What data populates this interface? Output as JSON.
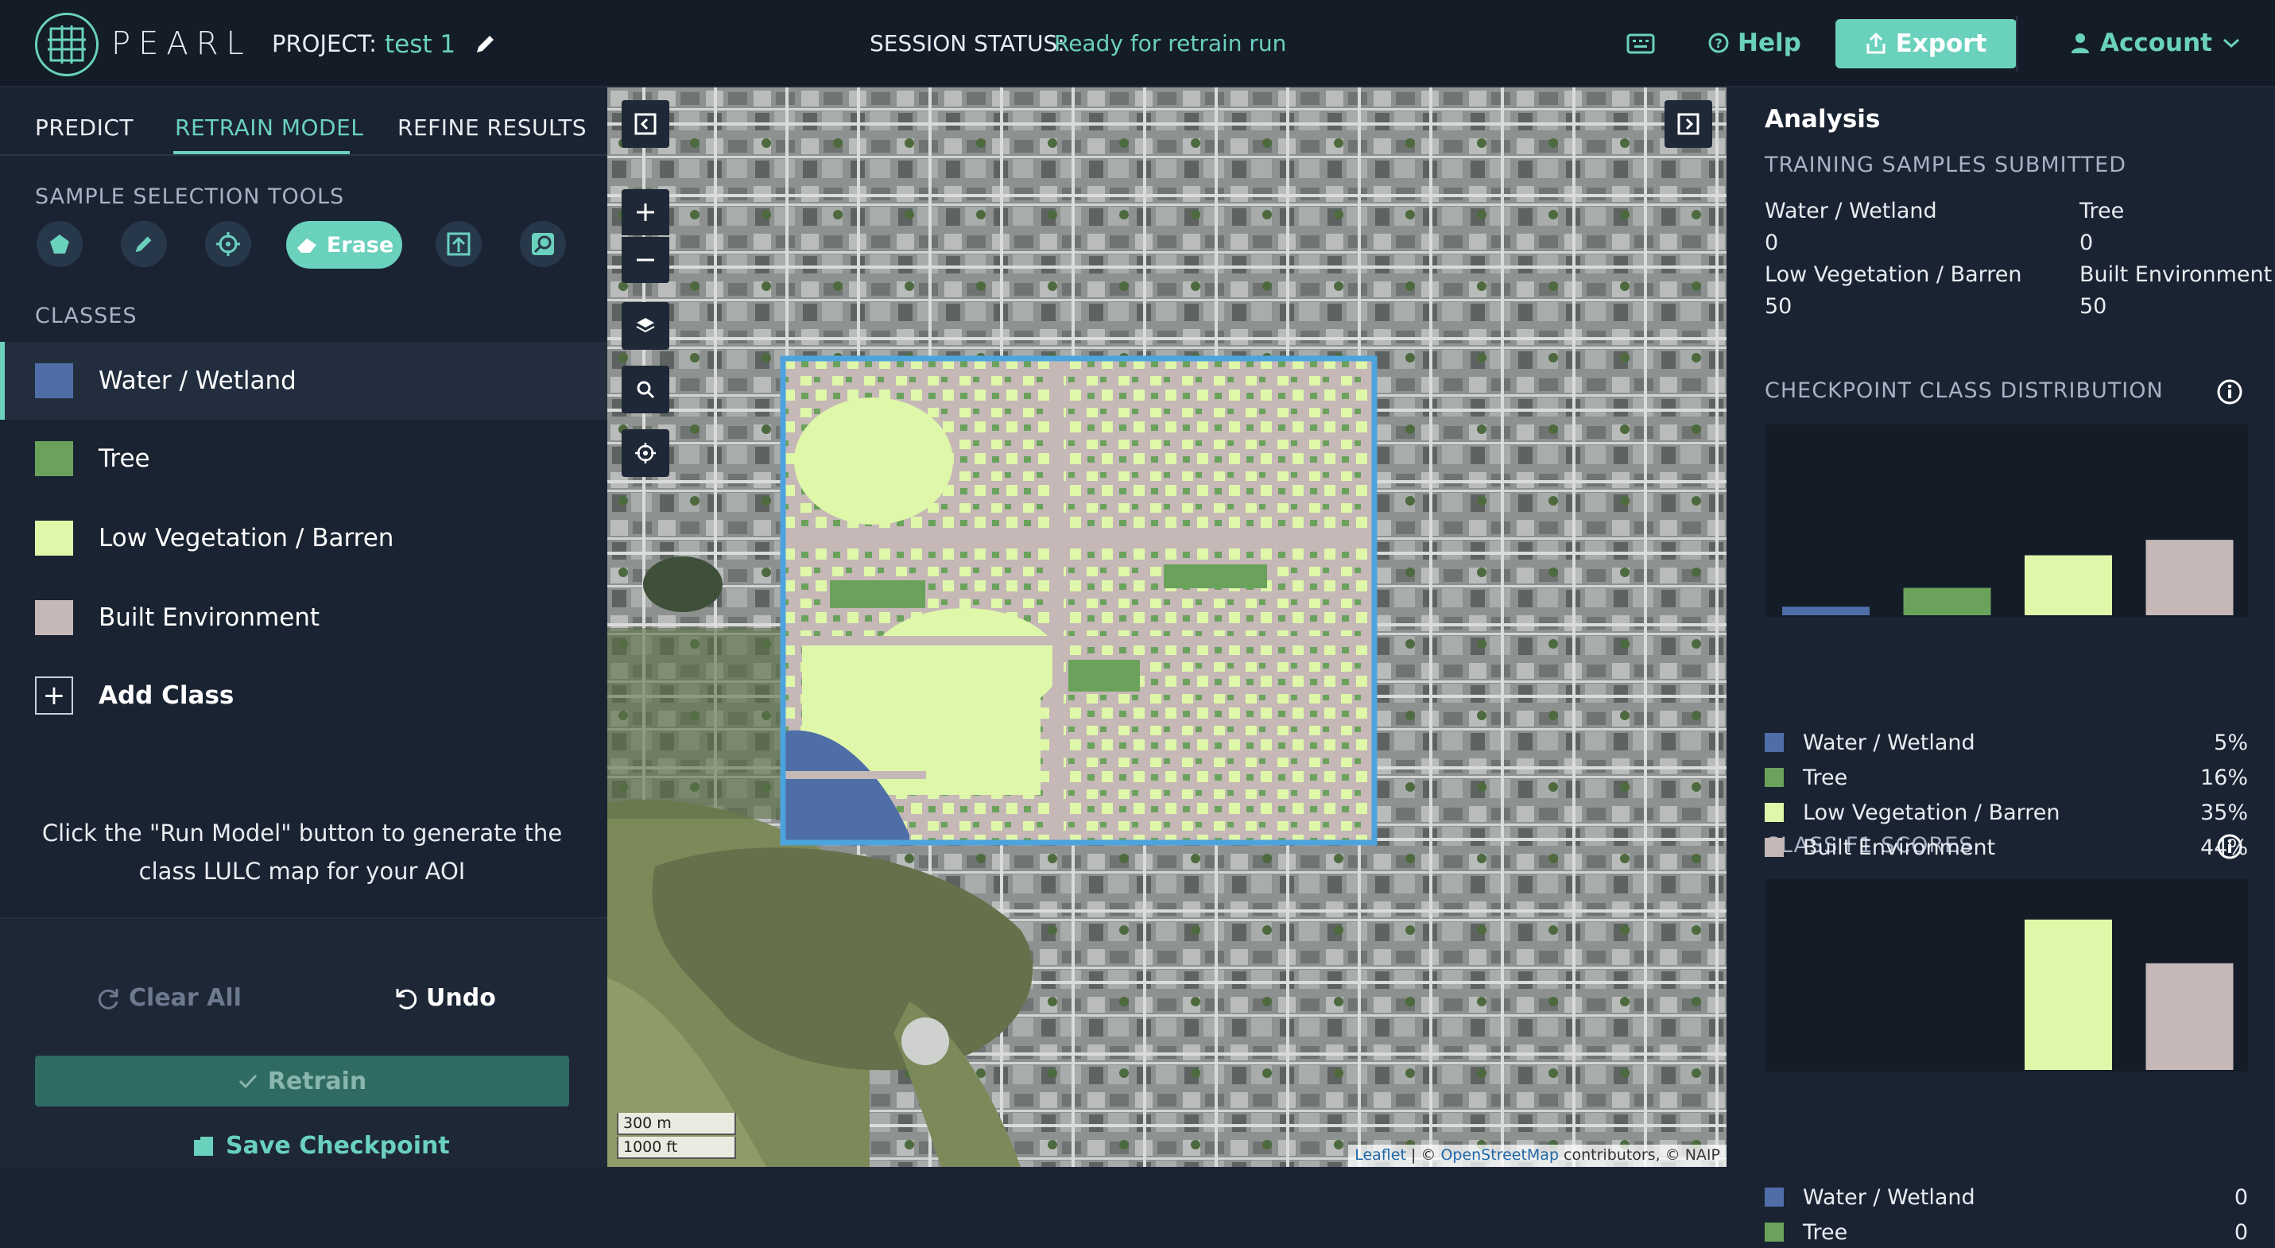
{
  "header": {
    "app_name": "PEARL",
    "project_label": "PROJECT:",
    "project_name": "test 1",
    "session_label": "SESSION STATUS:",
    "session_value": "Ready for retrain run",
    "help_label": "Help",
    "export_label": "Export",
    "account_label": "Account"
  },
  "tabs": [
    "PREDICT",
    "RETRAIN MODEL",
    "REFINE RESULTS"
  ],
  "tools": {
    "section_label": "SAMPLE SELECTION TOOLS",
    "erase_label": "Erase"
  },
  "classes": {
    "section_label": "CLASSES",
    "items": [
      {
        "name": "Water / Wetland",
        "color": "#4f6ea8"
      },
      {
        "name": "Tree",
        "color": "#6aa25c"
      },
      {
        "name": "Low Vegetation / Barren",
        "color": "#dff7a9"
      },
      {
        "name": "Built Environment",
        "color": "#c5b8b7"
      }
    ],
    "add_label": "Add Class"
  },
  "help_text": "Click the \"Run Model\" button to generate the class LULC map for your AOI",
  "actions": {
    "clear_all": "Clear All",
    "undo": "Undo",
    "retrain": "Retrain",
    "save_checkpoint": "Save Checkpoint"
  },
  "map": {
    "scale_metric": "300 m",
    "scale_imperial": "1000 ft",
    "attribution_leaflet": "Leaflet",
    "attribution_sep": " | © ",
    "attribution_osm": "OpenStreetMap",
    "attribution_rest": " contributors, © NAIP"
  },
  "analysis": {
    "title": "Analysis",
    "samples_label": "TRAINING SAMPLES SUBMITTED",
    "samples": [
      {
        "name": "Water / Wetland",
        "value": "0"
      },
      {
        "name": "Tree",
        "value": "0"
      },
      {
        "name": "Low Vegetation / Barren",
        "value": "50"
      },
      {
        "name": "Built Environment",
        "value": "50"
      }
    ],
    "distribution_label": "CHECKPOINT CLASS DISTRIBUTION",
    "f1_label": "CLASS F1 SCORES"
  },
  "chart_data": [
    {
      "type": "bar",
      "title": "CHECKPOINT CLASS DISTRIBUTION",
      "categories": [
        "Water / Wetland",
        "Tree",
        "Low Vegetation / Barren",
        "Built Environment"
      ],
      "values": [
        5,
        16,
        35,
        44
      ],
      "value_labels": [
        "5%",
        "16%",
        "35%",
        "44%"
      ],
      "colors": [
        "#4f6ea8",
        "#6aa25c",
        "#dff7a9",
        "#c5b8b7"
      ],
      "ylim": [
        0,
        100
      ]
    },
    {
      "type": "bar",
      "title": "CLASS F1 SCORES",
      "categories": [
        "Water / Wetland",
        "Tree",
        "Low Vegetation / Barren",
        "Built Environment"
      ],
      "values": [
        0,
        0,
        0.86,
        0.61
      ],
      "value_labels": [
        "0",
        "0"
      ],
      "colors": [
        "#4f6ea8",
        "#6aa25c",
        "#dff7a9",
        "#c5b8b7"
      ],
      "ylim": [
        0,
        1
      ]
    }
  ]
}
